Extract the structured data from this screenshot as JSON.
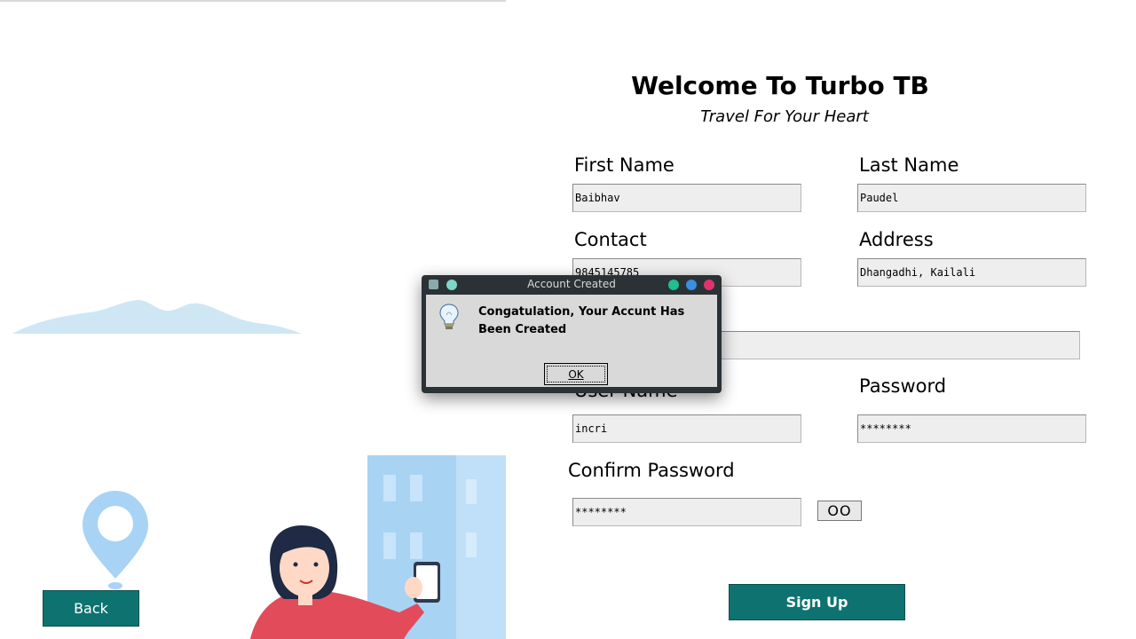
{
  "back_button": "Back",
  "header": {
    "title": "Welcome To Turbo TB",
    "subtitle": "Travel For Your Heart"
  },
  "form": {
    "first_name_label": "First Name",
    "first_name_value": "Baibhav",
    "last_name_label": "Last Name",
    "last_name_value": "Paudel",
    "contact_label": "Contact",
    "contact_value": "9845145785",
    "address_label": "Address",
    "address_value": "Dhangadhi, Kailali",
    "email_value": "",
    "username_label": "User Name",
    "username_value": "incri",
    "password_label": "Password",
    "password_value": "********",
    "confirm_password_label": "Confirm Password",
    "confirm_password_value": "********",
    "show_password_label": "OO",
    "signup_label": "Sign Up"
  },
  "dialog": {
    "title": "Account Created",
    "message": "Congatulation, Your Accunt Has Been Created",
    "ok_label": "OK",
    "icon": "lightbulb-icon"
  },
  "colors": {
    "accent": "#0e7370",
    "dialog_dot_green": "#1fbf8f",
    "dialog_dot_blue": "#3b8ee0",
    "dialog_dot_red": "#e0336e"
  }
}
